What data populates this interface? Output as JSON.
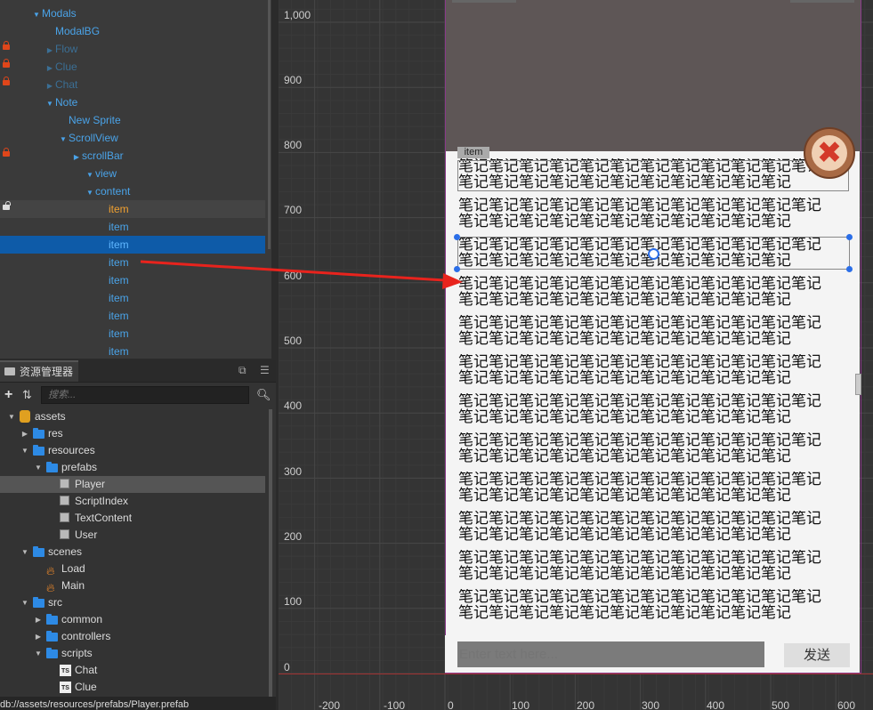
{
  "hierarchy": {
    "rows": [
      {
        "label": "Modals",
        "arrow": "▼"
      },
      {
        "label": "ModalBG",
        "arrow": ""
      },
      {
        "label": "Flow",
        "arrow": "▶"
      },
      {
        "label": "Clue",
        "arrow": "▶"
      },
      {
        "label": "Chat",
        "arrow": "▶"
      },
      {
        "label": "Note",
        "arrow": "▼"
      },
      {
        "label": "New Sprite",
        "arrow": ""
      },
      {
        "label": "ScrollView",
        "arrow": "▼"
      },
      {
        "label": "scrollBar",
        "arrow": "▶"
      },
      {
        "label": "view",
        "arrow": "▼"
      },
      {
        "label": "content",
        "arrow": "▼"
      },
      {
        "label": "item",
        "arrow": ""
      },
      {
        "label": "item",
        "arrow": ""
      },
      {
        "label": "item",
        "arrow": ""
      },
      {
        "label": "item",
        "arrow": ""
      },
      {
        "label": "item",
        "arrow": ""
      },
      {
        "label": "item",
        "arrow": ""
      },
      {
        "label": "item",
        "arrow": ""
      },
      {
        "label": "item",
        "arrow": ""
      },
      {
        "label": "item",
        "arrow": ""
      }
    ]
  },
  "assets": {
    "tab_label": "资源管理器",
    "search_placeholder": "搜索...",
    "tree": [
      {
        "label": "assets",
        "arrow": "▼",
        "icon": "db-icon"
      },
      {
        "label": "res",
        "arrow": "▶",
        "icon": "folder-icon"
      },
      {
        "label": "resources",
        "arrow": "▼",
        "icon": "folder-icon"
      },
      {
        "label": "prefabs",
        "arrow": "▼",
        "icon": "folder-icon"
      },
      {
        "label": "Player",
        "arrow": "",
        "icon": "prefab-icon"
      },
      {
        "label": "ScriptIndex",
        "arrow": "",
        "icon": "prefab-icon"
      },
      {
        "label": "TextContent",
        "arrow": "",
        "icon": "prefab-icon"
      },
      {
        "label": "User",
        "arrow": "",
        "icon": "prefab-icon"
      },
      {
        "label": "scenes",
        "arrow": "▼",
        "icon": "folder-icon"
      },
      {
        "label": "Load",
        "arrow": "",
        "icon": "scene-icon"
      },
      {
        "label": "Main",
        "arrow": "",
        "icon": "scene-icon"
      },
      {
        "label": "src",
        "arrow": "▼",
        "icon": "folder-icon"
      },
      {
        "label": "common",
        "arrow": "▶",
        "icon": "folder-icon"
      },
      {
        "label": "controllers",
        "arrow": "▶",
        "icon": "folder-icon"
      },
      {
        "label": "scripts",
        "arrow": "▼",
        "icon": "folder-icon"
      },
      {
        "label": "Chat",
        "arrow": "",
        "icon": "ts-icon"
      },
      {
        "label": "Clue",
        "arrow": "",
        "icon": "ts-icon"
      }
    ],
    "ts_badge": "TS",
    "status_path": "db://assets/resources/prefabs/Player.prefab"
  },
  "scene": {
    "y_labels": [
      "1,000",
      "900",
      "800",
      "700",
      "600",
      "500",
      "400",
      "300",
      "200",
      "100",
      "0"
    ],
    "x_labels": [
      "-200",
      "-100",
      "0",
      "100",
      "200",
      "300",
      "400",
      "500",
      "600"
    ],
    "item_tag": "item",
    "note_line1": "笔记笔记笔记笔记笔记笔记笔记笔记笔记笔记笔记笔记",
    "note_line2": "笔记笔记笔记笔记笔记笔记笔记笔记笔记笔记笔记",
    "close_glyph": "✖",
    "input_placeholder": "Enter text here...",
    "send_label": "发送"
  },
  "colors": {
    "accent": "#0e5ba8",
    "link": "#4aa3e8",
    "highlight": "#f0a030",
    "lock": "#e0461a",
    "arrow": "#e8231d"
  }
}
